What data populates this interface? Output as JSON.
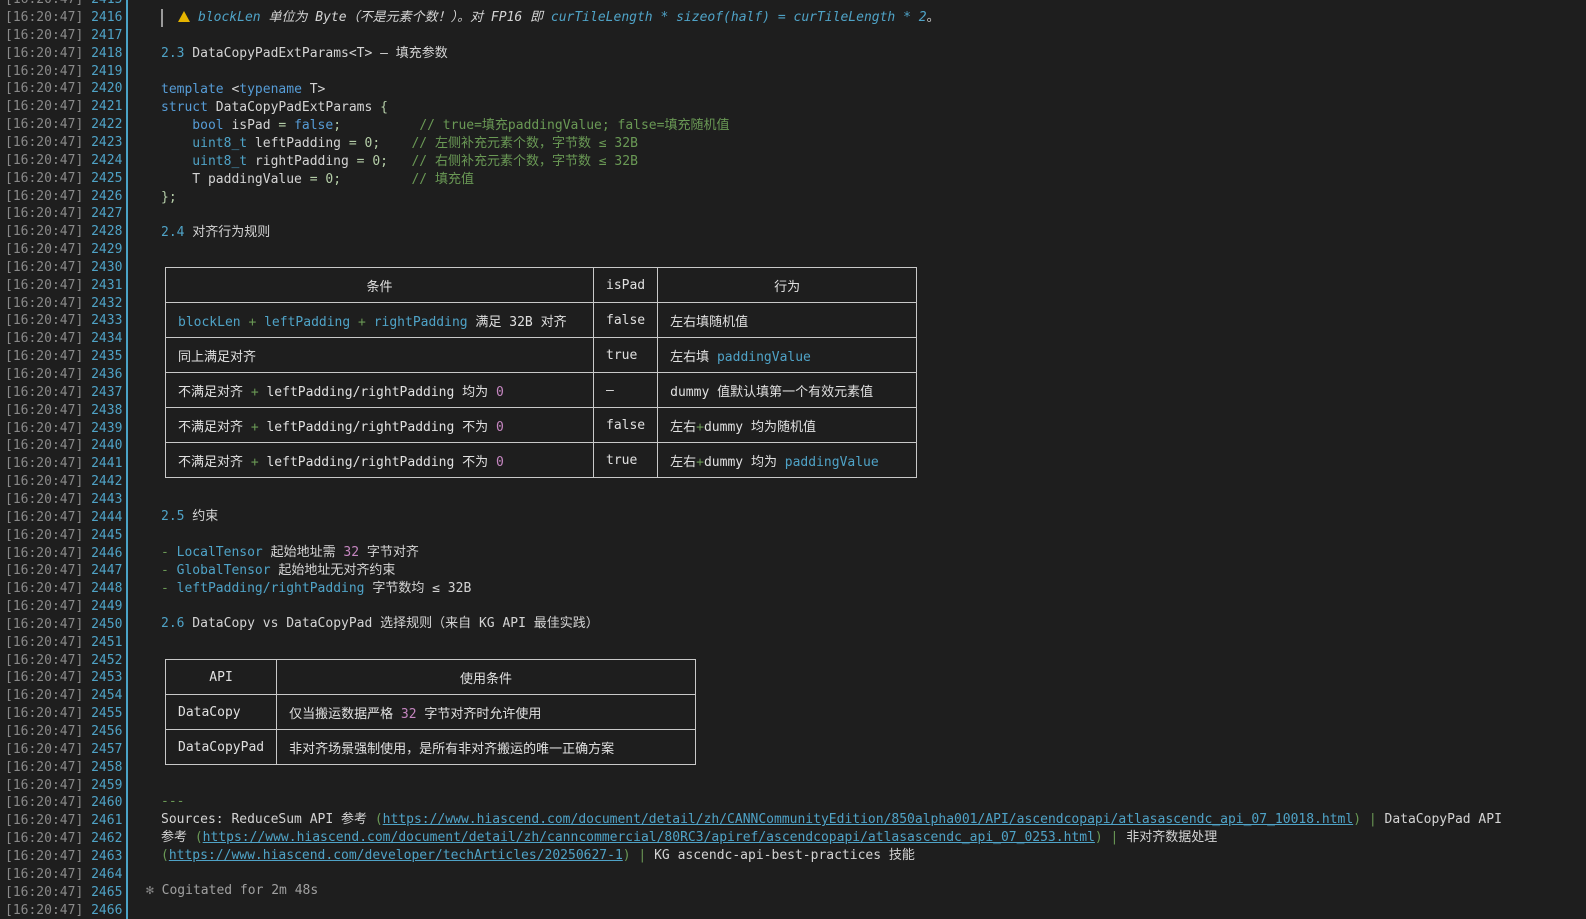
{
  "gutter": {
    "timestamp": "[16:20:47]",
    "first_partial": "2415",
    "last_partial": "2466",
    "lines": [
      "2416",
      "2417",
      "2418",
      "2419",
      "2420",
      "2421",
      "2422",
      "2423",
      "2424",
      "2425",
      "2426",
      "2427",
      "2428",
      "2429",
      "2430",
      "2431",
      "2432",
      "2433",
      "2434",
      "2435",
      "2436",
      "2437",
      "2438",
      "2439",
      "2440",
      "2441",
      "2442",
      "2443",
      "2444",
      "2445",
      "2446",
      "2447",
      "2448",
      "2449",
      "2450",
      "2451",
      "2452",
      "2453",
      "2454",
      "2455",
      "2456",
      "2457",
      "2458",
      "2459",
      "2460",
      "2461",
      "2462",
      "2463",
      "2464",
      "2465"
    ]
  },
  "warning": {
    "a": "blockLen",
    "b": " 单位为 Byte（不是元素个数！）。对 FP16 即 ",
    "c": "curTileLength * sizeof(half) = curTileLength * 2",
    "d": "。"
  },
  "sec23": {
    "num": "2.3",
    "title": " DataCopyPadExtParams<T> — 填充参数"
  },
  "code": {
    "l1_kw": "template",
    "l1_a": " <",
    "l1_kw2": "typename",
    "l1_b": " T>",
    "l2_kw": "struct",
    "l2_b": " DataCopyPadExtParams ",
    "l2_c": "{",
    "l3_t": "    bool",
    "l3_v": " isPad ",
    "l3_eq": "= ",
    "l3_f": "false",
    "l3_s": ";",
    "l3_cm": "          // true=填充paddingValue; false=填充随机值",
    "l4_t": "    uint8_t",
    "l4_v": " leftPadding ",
    "l4_eq": "= 0;",
    "l4_cm": "    // 左侧补充元素个数，字节数 ≤ 32B",
    "l5_t": "    uint8_t",
    "l5_v": " rightPadding ",
    "l5_eq": "= 0;",
    "l5_cm": "   // 右侧补充元素个数，字节数 ≤ 32B",
    "l6_v": "    T paddingValue ",
    "l6_eq": "= 0;",
    "l6_cm": "         // 填充值",
    "l7": "};"
  },
  "sec24": {
    "num": "2.4",
    "title": " 对齐行为规则"
  },
  "table1": {
    "headers": [
      "条件",
      "isPad",
      "行为"
    ],
    "rows": [
      {
        "c1a": "blockLen",
        "c1b": " + ",
        "c1c": "leftPadding",
        "c1d": " + ",
        "c1e": "rightPadding",
        "c1f": " 满足 32B 对齐",
        "c2": "false",
        "c3a": "左右填随机值",
        "c3b": ""
      },
      {
        "c1a": "同上满足对齐",
        "c2": "true",
        "c3a": "左右填 ",
        "c3b": "paddingValue"
      },
      {
        "c1a": "不满足对齐 ",
        "c1b": "+",
        "c1c": " leftPadding/rightPadding 均为 ",
        "c1d": "0",
        "c2": "—",
        "c3a": "dummy 值默认填第一个有效元素值",
        "c3b": ""
      },
      {
        "c1a": "不满足对齐 ",
        "c1b": "+",
        "c1c": " leftPadding/rightPadding 不为 ",
        "c1d": "0",
        "c2": "false",
        "c3a": "左右",
        "c3p": "+",
        "c3c": "dummy 均为随机值",
        "c3b": ""
      },
      {
        "c1a": "不满足对齐 ",
        "c1b": "+",
        "c1c": " leftPadding/rightPadding 不为 ",
        "c1d": "0",
        "c2": "true",
        "c3a": "左右",
        "c3p": "+",
        "c3c": "dummy 均为 ",
        "c3b": "paddingValue"
      }
    ]
  },
  "sec25": {
    "num": "2.5",
    "title": " 约束"
  },
  "constraints": [
    {
      "dash": "- ",
      "name": "LocalTensor",
      "a": " 起始地址需 ",
      "n": "32",
      "b": " 字节对齐"
    },
    {
      "dash": "- ",
      "name": "GlobalTensor",
      "a": " 起始地址无对齐约束",
      "n": "",
      "b": ""
    },
    {
      "dash": "- ",
      "name": "leftPadding/rightPadding",
      "a": " 字节数均 ≤ 32B",
      "n": "",
      "b": ""
    }
  ],
  "sec26": {
    "num": "2.6",
    "title": " DataCopy vs DataCopyPad 选择规则（来自 KG API 最佳实践）"
  },
  "table2": {
    "headers": [
      "API",
      "使用条件"
    ],
    "rows": [
      {
        "api": "DataCopy",
        "a": "仅当搬运数据严格 ",
        "n": "32",
        "b": " 字节对齐时允许使用"
      },
      {
        "api": "DataCopyPad",
        "a": "非对齐场景强制使用，是所有非对齐搬运的唯一正确方案",
        "n": "",
        "b": ""
      }
    ]
  },
  "hr": "---",
  "sources": {
    "label": "Sources: ReduceSum API 参考 ",
    "p1": "(",
    "url1": "https://www.hiascend.com/document/detail/zh/CANNCommunityEdition/850alpha001/API/ascendcopapi/atlasascendc_api_07_10018.html",
    "p2": ")",
    "sep1": " | ",
    "t2": "DataCopyPad API",
    "t2b": "参考 ",
    "p3": "(",
    "url2": "https://www.hiascend.com/document/detail/zh/canncommercial/80RC3/apiref/ascendcopapi/atlasascendc_api_07_0253.html",
    "p4": ")",
    "sep2": " | ",
    "t3": "非对齐数据处理",
    "p5": "(",
    "url3": "https://www.hiascend.com/developer/techArticles/20250627-1",
    "p6": ")",
    "sep3": " | ",
    "t4": "KG ascendc-api-best-practices 技能"
  },
  "status": {
    "spinner": "✻",
    "text": " Cogitated for 2m 48s"
  },
  "colors": {
    "accent": "#4fa3c7",
    "warning": "#e5b400",
    "comment": "#6a9955",
    "number": "#c586c0"
  }
}
